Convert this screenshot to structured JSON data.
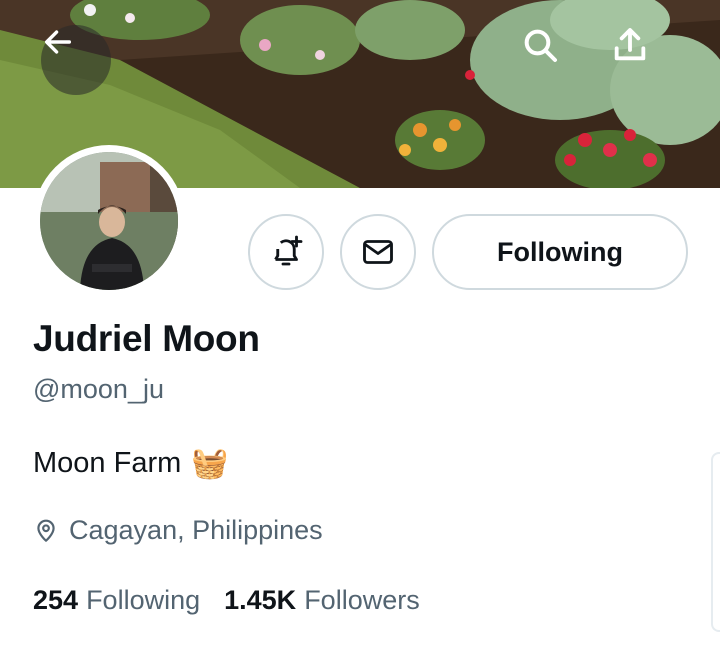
{
  "header": {
    "back_icon": "arrow-left-icon",
    "search_icon": "search-icon",
    "share_icon": "share-upload-icon"
  },
  "profile": {
    "name": "Judriel Moon",
    "handle": "@moon_ju",
    "bio": "Moon Farm",
    "bio_emoji": "🧺",
    "location": "Cagayan, Philippines",
    "location_icon": "location-pin-icon"
  },
  "actions": {
    "notify_icon": "bell-plus-icon",
    "message_icon": "envelope-icon",
    "follow_label": "Following"
  },
  "stats": {
    "following_count": "254",
    "following_label": "Following",
    "followers_count": "1.45K",
    "followers_label": "Followers"
  },
  "colors": {
    "text_primary": "#0f1419",
    "text_secondary": "#536471",
    "button_border": "#cfd9de"
  }
}
